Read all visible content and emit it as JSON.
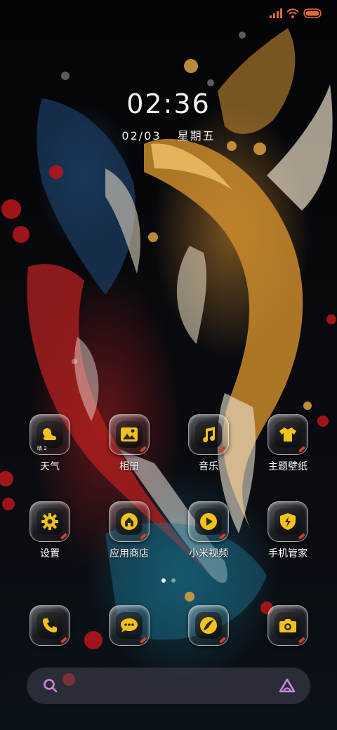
{
  "status_bar": {
    "icons": [
      "signal-icon",
      "wifi-icon",
      "battery-icon"
    ]
  },
  "lock": {
    "time": "02:36",
    "date": "02/03",
    "weekday": "星期五"
  },
  "apps": [
    {
      "label": "天气",
      "icon": "weather-icon",
      "badge": "晴 2"
    },
    {
      "label": "相册",
      "icon": "gallery-icon"
    },
    {
      "label": "音乐",
      "icon": "music-icon"
    },
    {
      "label": "主题壁纸",
      "icon": "theme-icon"
    },
    {
      "label": "设置",
      "icon": "settings-icon"
    },
    {
      "label": "应用商店",
      "icon": "app-store-icon"
    },
    {
      "label": "小米视频",
      "icon": "video-icon"
    },
    {
      "label": "手机管家",
      "icon": "security-icon"
    }
  ],
  "dock": [
    {
      "icon": "phone-icon"
    },
    {
      "icon": "messages-icon"
    },
    {
      "icon": "browser-icon"
    },
    {
      "icon": "camera-icon"
    }
  ],
  "page_indicator": {
    "pages": 2,
    "current": 1
  },
  "search_bar": {
    "left_icon": "search-icon",
    "right_icon": "assistant-icon"
  },
  "colors": {
    "icon_gold": "#f2c21b",
    "icon_accent_red": "#d43a2a",
    "text": "#ffffff"
  }
}
